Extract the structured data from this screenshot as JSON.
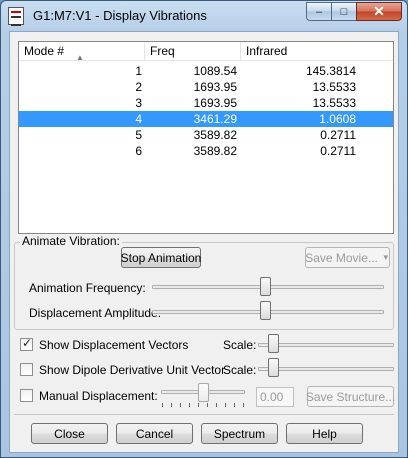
{
  "window": {
    "title": "G1:M7:V1 - Display Vibrations",
    "minimize_glyph": "–",
    "maximize_glyph": "□",
    "close_glyph": "✕"
  },
  "table": {
    "columns": [
      "Mode #",
      "Freq",
      "Infrared"
    ],
    "sort_indicator": "▲",
    "rows": [
      {
        "mode": "1",
        "freq": "1089.54",
        "ir": "145.3814"
      },
      {
        "mode": "2",
        "freq": "1693.95",
        "ir": "13.5533"
      },
      {
        "mode": "3",
        "freq": "1693.95",
        "ir": "13.5533"
      },
      {
        "mode": "4",
        "freq": "3461.29",
        "ir": "1.0608"
      },
      {
        "mode": "5",
        "freq": "3589.82",
        "ir": "0.2711"
      },
      {
        "mode": "6",
        "freq": "3589.82",
        "ir": "0.2711"
      }
    ],
    "selected_mode": "4"
  },
  "animate": {
    "group_label": "Animate Vibration:",
    "stop_button": "Stop Animation",
    "save_movie_button": "Save Movie...",
    "frequency_label": "Animation Frequency:",
    "amplitude_label": "Displacement Amplitude:"
  },
  "options": {
    "show_vectors_label": "Show Displacement Vectors",
    "show_vectors_checked": true,
    "show_dipole_label": "Show Dipole Derivative Unit Vector",
    "show_dipole_checked": false,
    "scale_label": "Scale:",
    "manual_label": "Manual Displacement:",
    "manual_checked": false,
    "manual_value": "0.00",
    "save_structure_button": "Save Structure..."
  },
  "buttons": {
    "close": "Close",
    "cancel": "Cancel",
    "spectrum": "Spectrum",
    "help": "Help"
  },
  "icons": {
    "checkmark": "✓",
    "dropdown_arrow": "▼"
  }
}
